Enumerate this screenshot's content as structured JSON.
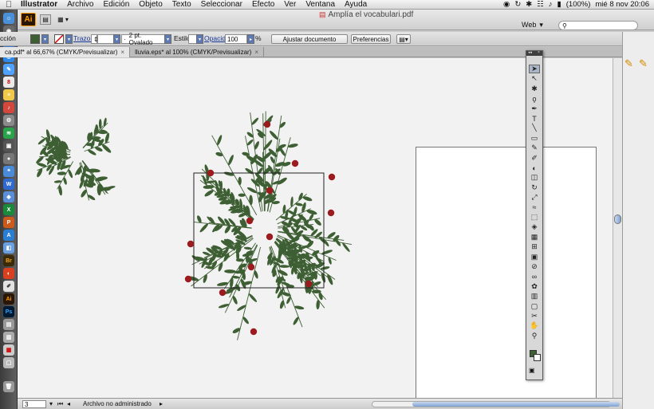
{
  "menubar": {
    "app_name": "Illustrator",
    "items": [
      "Archivo",
      "Edición",
      "Objeto",
      "Texto",
      "Seleccionar",
      "Efecto",
      "Ver",
      "Ventana",
      "Ayuda"
    ],
    "battery": "(100%)",
    "clock": "mié 8 nov  20:06"
  },
  "app_bar": {
    "logo": "Ai",
    "document_title": "Amplía el vocabulari.pdf",
    "workspace": "Web",
    "search_placeholder": ""
  },
  "control_panel": {
    "selection_label": "cción",
    "stroke_label": "Trazo:",
    "brush_value": "2 pt. Ovalado",
    "style_label": "Estilo:",
    "opacity_label": "Opacidad:",
    "opacity_value": "100",
    "opacity_unit": "%",
    "fit_document_button": "Ajustar documento",
    "preferences_button": "Preferencias",
    "fill_color": "#3e5f34"
  },
  "tabs": [
    {
      "label": "ca.pdf* al 66,67% (CMYK/Previsualizar)",
      "active": true
    },
    {
      "label": "lluvia.eps* al 100% (CMYK/Previsualizar)",
      "active": false
    }
  ],
  "status_bar": {
    "zoom": "3",
    "status_text": "Archivo no administrado"
  },
  "colors": {
    "leaf": "#3e5f34",
    "berry": "#9b1b1e",
    "canvas": "#f2f2f2",
    "artboard": "#ffffff"
  },
  "tools": [
    "selection-tool-icon",
    "direct-selection-tool-icon",
    "magic-wand-icon",
    "lasso-icon",
    "pen-tool-icon",
    "type-tool-icon",
    "line-tool-icon",
    "rectangle-tool-icon",
    "paintbrush-icon",
    "pencil-icon",
    "blob-brush-icon",
    "eraser-icon",
    "rotate-tool-icon",
    "scale-tool-icon",
    "warp-tool-icon",
    "free-transform-icon",
    "shape-builder-icon",
    "perspective-grid-icon",
    "mesh-tool-icon",
    "gradient-tool-icon",
    "eyedropper-icon",
    "blend-tool-icon",
    "symbol-sprayer-icon",
    "column-graph-icon",
    "artboard-tool-icon",
    "slice-tool-icon",
    "hand-tool-icon",
    "zoom-tool-icon"
  ]
}
